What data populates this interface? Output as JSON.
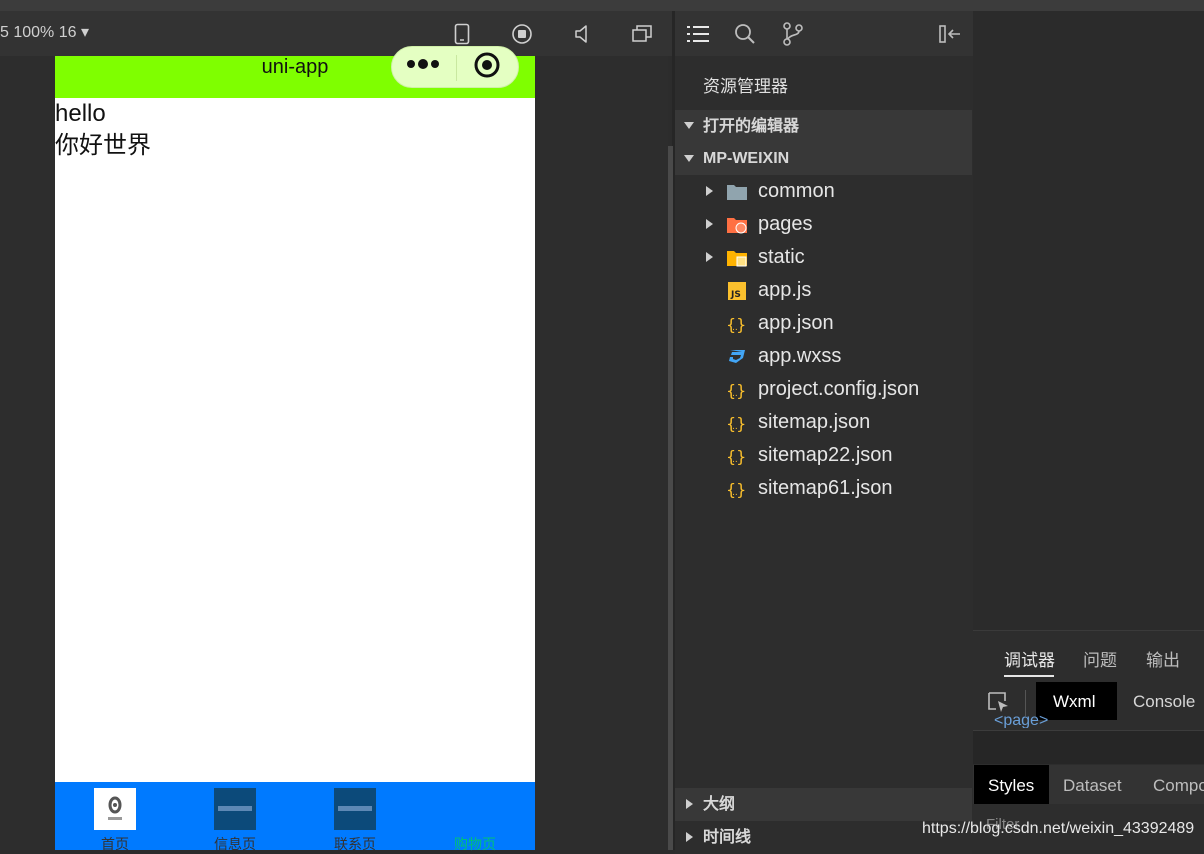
{
  "toolbar": {
    "zoom_text": "5 100% 16 ▾",
    "icons": [
      "phone-icon",
      "record-stop-icon",
      "speaker-icon",
      "window-icon"
    ]
  },
  "simulator": {
    "nav_title": "uni-app",
    "nav_bg": "#7fff00",
    "content_lines": [
      "hello",
      "你好世界"
    ],
    "tabbar_bg": "#007aff",
    "tabs": [
      {
        "label": "首页",
        "icon": "csdn-logo-icon"
      },
      {
        "label": "信息页",
        "icon": "uni-app-icon"
      },
      {
        "label": "联系页",
        "icon": "uni-app-icon"
      },
      {
        "label": "购物页",
        "icon": "",
        "active": true
      }
    ]
  },
  "explorer": {
    "title": "资源管理器",
    "open_editors": "打开的编辑器",
    "project": "MP-WEIXIN",
    "files": [
      {
        "name": "common",
        "icon": "folder-icon",
        "expandable": true
      },
      {
        "name": "pages",
        "icon": "folder-pages-icon",
        "expandable": true
      },
      {
        "name": "static",
        "icon": "folder-static-icon",
        "expandable": true
      },
      {
        "name": "app.js",
        "icon": "js-icon",
        "expandable": false
      },
      {
        "name": "app.json",
        "icon": "json-icon",
        "expandable": false
      },
      {
        "name": "app.wxss",
        "icon": "css-icon",
        "expandable": false
      },
      {
        "name": "project.config.json",
        "icon": "json-icon",
        "expandable": false
      },
      {
        "name": "sitemap.json",
        "icon": "json-icon",
        "expandable": false
      },
      {
        "name": "sitemap22.json",
        "icon": "json-icon",
        "expandable": false
      },
      {
        "name": "sitemap61.json",
        "icon": "json-icon",
        "expandable": false
      }
    ],
    "outline": "大纲",
    "timeline": "时间线"
  },
  "debugger": {
    "tabs": [
      "调试器",
      "问题",
      "输出"
    ],
    "subtabs": [
      "Wxml",
      "Console"
    ],
    "page_tag": "<page>",
    "style_tabs": [
      "Styles",
      "Dataset",
      "Compo"
    ],
    "filter": "Filter"
  },
  "watermark": "https://blog.csdn.net/weixin_43392489"
}
